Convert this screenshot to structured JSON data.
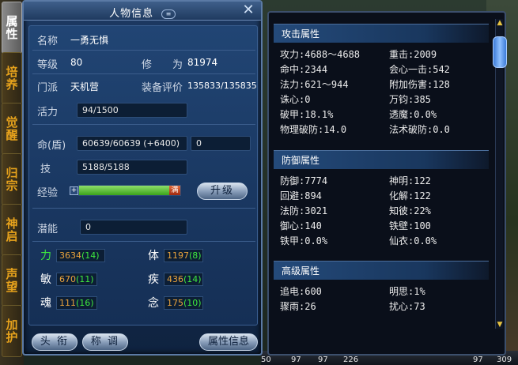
{
  "window": {
    "title": "人物信息",
    "title_icon": "list-toggle-icon",
    "title_icon_text": "≡"
  },
  "tabs": [
    "属性",
    "培养",
    "觉醒",
    "归宗",
    "神启",
    "声望",
    "加护"
  ],
  "profile": {
    "name_label": "名称",
    "name_value": "一勇无惧",
    "level_label": "等级",
    "level_value": "80",
    "cultivation_label": "修　　为",
    "cultivation_value": "81974",
    "sect_label": "门派",
    "sect_value": "天机营",
    "rating_label": "装备评价",
    "rating_value": "135833/135835",
    "vitality_label": "活力",
    "vitality_value": "94/1500",
    "hp_label": "命(盾)",
    "hp_value": "60639/60639 (+6400)",
    "shield_value": "0",
    "skill_label": "技",
    "skill_value": "5188/5188",
    "exp_label": "经验",
    "exp_plus": "+",
    "exp_full_label": "满",
    "exp_progress": 1.0,
    "upgrade_button": "升级",
    "potential_label": "潜能",
    "potential_value": "0"
  },
  "attributes": [
    {
      "label": "力",
      "base": "3634",
      "bonus": "(14)"
    },
    {
      "label": "体",
      "base": "1197",
      "bonus": "(8)"
    },
    {
      "label": "敏",
      "base": "670",
      "bonus": "(11)"
    },
    {
      "label": "疾",
      "base": "436",
      "bonus": "(14)"
    },
    {
      "label": "魂",
      "base": "111",
      "bonus": "(16)"
    },
    {
      "label": "念",
      "base": "175",
      "bonus": "(10)"
    }
  ],
  "footer": {
    "title_btn": "头 衔",
    "call_btn": "称 调",
    "attr_info_btn": "属性信息"
  },
  "right": {
    "attack_header": "攻击属性",
    "attack": [
      [
        "攻力:4688～4688",
        "重击:2009"
      ],
      [
        "命中:2344",
        "会心一击:542"
      ],
      [
        "法力:621～944",
        "附加伤害:128"
      ],
      [
        "诛心:0",
        "万钧:385"
      ],
      [
        "破甲:18.1%",
        "透魔:0.0%"
      ],
      [
        "物理破防:14.0",
        "法术破防:0.0"
      ]
    ],
    "defense_header": "防御属性",
    "defense": [
      [
        "防御:7774",
        "神明:122"
      ],
      [
        "回避:894",
        "化解:122"
      ],
      [
        "法防:3021",
        "知彼:22%"
      ],
      [
        "御心:140",
        "铁壁:100"
      ],
      [
        "铁甲:0.0%",
        "仙衣:0.0%"
      ]
    ],
    "advanced_header": "高级属性",
    "advanced": [
      [
        "追电:600",
        "明思:1%"
      ],
      [
        "骤雨:26",
        "扰心:73"
      ]
    ]
  },
  "bottom_numbers": [
    "50",
    "97",
    "97",
    "226",
    "97",
    "309"
  ]
}
